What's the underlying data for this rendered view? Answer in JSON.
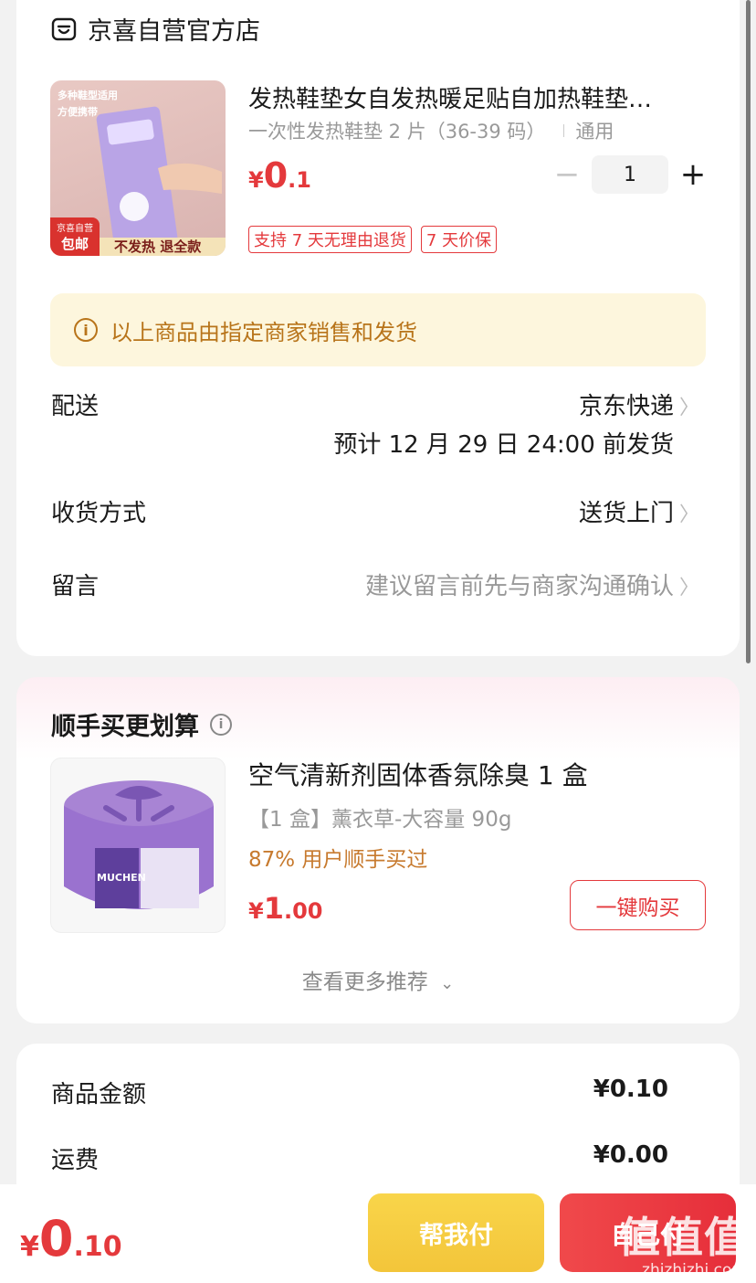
{
  "store": {
    "name": "京喜自营官方店",
    "icon": "store-icon"
  },
  "product": {
    "title": "发热鞋垫女自发热暖足贴自加热鞋垫…",
    "spec": "一次性发热鞋垫 2 片（36-39 码）",
    "spec_extra": "通用",
    "price": {
      "currency": "¥",
      "integer": "0",
      "decimal": ".1"
    },
    "quantity": "1",
    "minus": "−",
    "plus": "+",
    "tags": [
      "支持 7 天无理由退货",
      "7 天价保"
    ],
    "thumb_text": {
      "badge_top": "多种鞋型适用",
      "badge_sub": "方便携带",
      "corner_top": "京喜自营",
      "corner_bottom": "包邮",
      "promo": "不发热 退全款"
    }
  },
  "notice": "以上商品由指定商家销售和发货",
  "delivery": {
    "label": "配送",
    "value": "京东快递",
    "eta": "预计 12 月 29 日 24:00 前发货"
  },
  "receive_method": {
    "label": "收货方式",
    "value": "送货上门"
  },
  "message": {
    "label": "留言",
    "placeholder": "建议留言前先与商家沟通确认"
  },
  "recommend": {
    "title": "顺手买更划算",
    "item": {
      "title": "空气清新剂固体香氛除臭 1 盒",
      "spec": "【1 盒】薰衣草-大容量 90g",
      "buyers": "87% 用户顺手买过",
      "price": {
        "currency": "¥",
        "integer": "1",
        "decimal": ".00"
      },
      "brand_text": "MUCHEN",
      "buy_label": "一键购买"
    },
    "more_label": "查看更多推荐"
  },
  "summary": {
    "goods_label": "商品金额",
    "goods_value": "¥0.10",
    "shipping_label": "运费",
    "shipping_value": "¥0.00"
  },
  "bottom": {
    "total": {
      "currency": "¥",
      "integer": "0",
      "decimal": ".10"
    },
    "help_pay_label": "帮我付",
    "pay_label": "自己付",
    "watermark": "值值值",
    "watermark_url": "zhizhizhi.com"
  },
  "colors": {
    "accent_red": "#e4393c",
    "notice_bg": "#fdf6dd",
    "notice_text": "#b8741a",
    "help_btn": "#f3c53a",
    "buyers_text": "#c77a2e"
  }
}
